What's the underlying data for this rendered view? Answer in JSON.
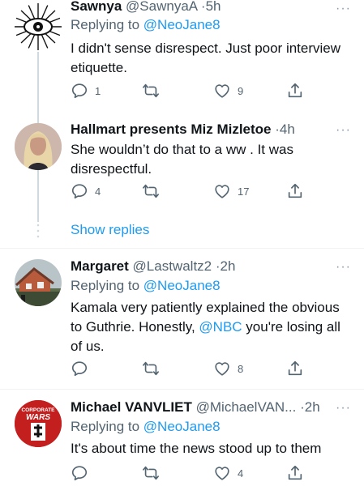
{
  "tweets": [
    {
      "name": "Sawnya",
      "handle": "@SawnyaA",
      "time": "5h",
      "replying_label": "Replying to",
      "replying_to": "@NeoJane8",
      "text": "I didn't sense disrespect. Just poor interview etiquette.",
      "replies": "1",
      "likes": "9"
    },
    {
      "name": "Hallmart presents Miz Mizletoe",
      "time": "4h",
      "text": "She wouldn’t do that to a ww . It was disrespectful.",
      "replies": "4",
      "likes": "17"
    },
    {
      "name": "Margaret",
      "handle": "@Lastwaltz2",
      "time": "2h",
      "replying_label": "Replying to",
      "replying_to": "@NeoJane8",
      "text_before": "Kamala very patiently explained the obvious to Guthrie. Honestly, ",
      "text_mention": "@NBC",
      "text_after": " you're losing all of us.",
      "likes": "8"
    },
    {
      "name": "Michael VANVLIET",
      "handle": "@MichaelVAN...",
      "time": "2h",
      "replying_label": "Replying to",
      "replying_to": "@NeoJane8",
      "text": "It's about time the news stood up to them",
      "likes": "4",
      "avatar_text_1": "CORPORATE",
      "avatar_text_2": "WARS"
    }
  ],
  "show_replies": "Show replies",
  "more_glyph": "···",
  "separator": "·",
  "colors": {
    "link": "#1d9bf0",
    "secondary_text": "#536471",
    "icon": "#536471",
    "thread_line": "#cfd9de"
  }
}
